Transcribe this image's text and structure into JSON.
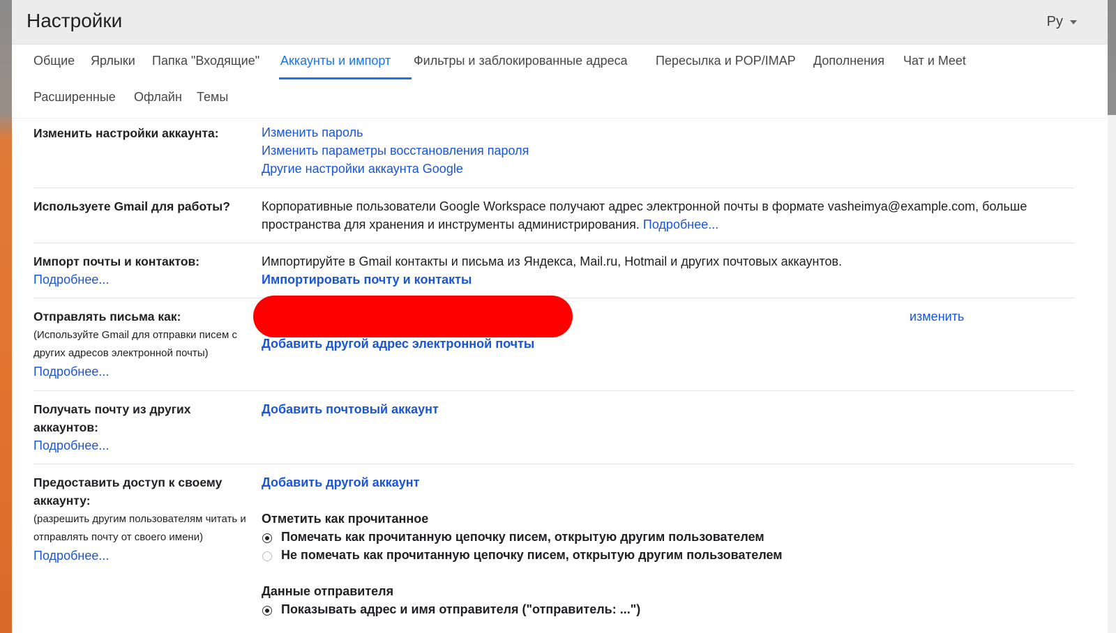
{
  "header": {
    "title": "Настройки",
    "lang": "Ру"
  },
  "tabs": [
    {
      "label": "Общие"
    },
    {
      "label": "Ярлыки"
    },
    {
      "label": "Папка \"Входящие\""
    },
    {
      "label": "Аккаунты и импорт"
    },
    {
      "label": "Фильтры и заблокированные адреса"
    },
    {
      "label": "Пересылка и POP/IMAP"
    },
    {
      "label": "Дополнения"
    },
    {
      "label": "Чат и Meet"
    },
    {
      "label": "Расширенные"
    },
    {
      "label": "Офлайн"
    },
    {
      "label": "Темы"
    }
  ],
  "active_tab": "Аккаунты и импорт",
  "sections": {
    "account": {
      "label": "Изменить настройки аккаунта:",
      "links": [
        "Изменить пароль",
        "Изменить параметры восстановления пароля",
        "Другие настройки аккаунта Google"
      ]
    },
    "work": {
      "label": "Используете Gmail для работы?",
      "text1": "Корпоративные пользователи Google Workspace получают адрес электронной почты в формате vasheimya@example.com, больше",
      "text2": "пространства для хранения и инструменты администрирования.",
      "more": "Подробнее..."
    },
    "import": {
      "label": "Импорт почты и контактов:",
      "more": "Подробнее...",
      "text": "Импортируйте в Gmail контакты и письма из Яндекса, Mail.ru, Hotmail и других почтовых аккаунтов.",
      "action": "Импортировать почту и контакты"
    },
    "send_as": {
      "label": "Отправлять письма как:",
      "sub1": "(Используйте Gmail для отправки писем с",
      "sub2": "других адресов электронной почты)",
      "more": "Подробнее...",
      "edit": "изменить",
      "action": "Добавить другой адрес электронной почты"
    },
    "check_mail": {
      "label1": "Получать почту из других",
      "label2": "аккаунтов:",
      "more": "Подробнее...",
      "action": "Добавить почтовый аккаунт"
    },
    "grant": {
      "label1": "Предоставить доступ к своему",
      "label2": "аккаунту:",
      "sub1": "(разрешить другим пользователям читать и",
      "sub2": "отправлять почту от своего имени)",
      "more": "Подробнее...",
      "action": "Добавить другой аккаунт",
      "mark_read_title": "Отметить как прочитанное",
      "mark_read_opt1": "Помечать как прочитанную цепочку писем, открытую другим пользователем",
      "mark_read_opt2": "Не помечать как прочитанную цепочку писем, открытую другим пользователем",
      "sender_title": "Данные отправителя",
      "sender_opt1": "Показывать адрес и имя отправителя (\"отправитель: ...\")"
    }
  },
  "colors": {
    "accent": "#1a73e8",
    "link": "#1a55d4",
    "redaction": "#ff0000"
  }
}
